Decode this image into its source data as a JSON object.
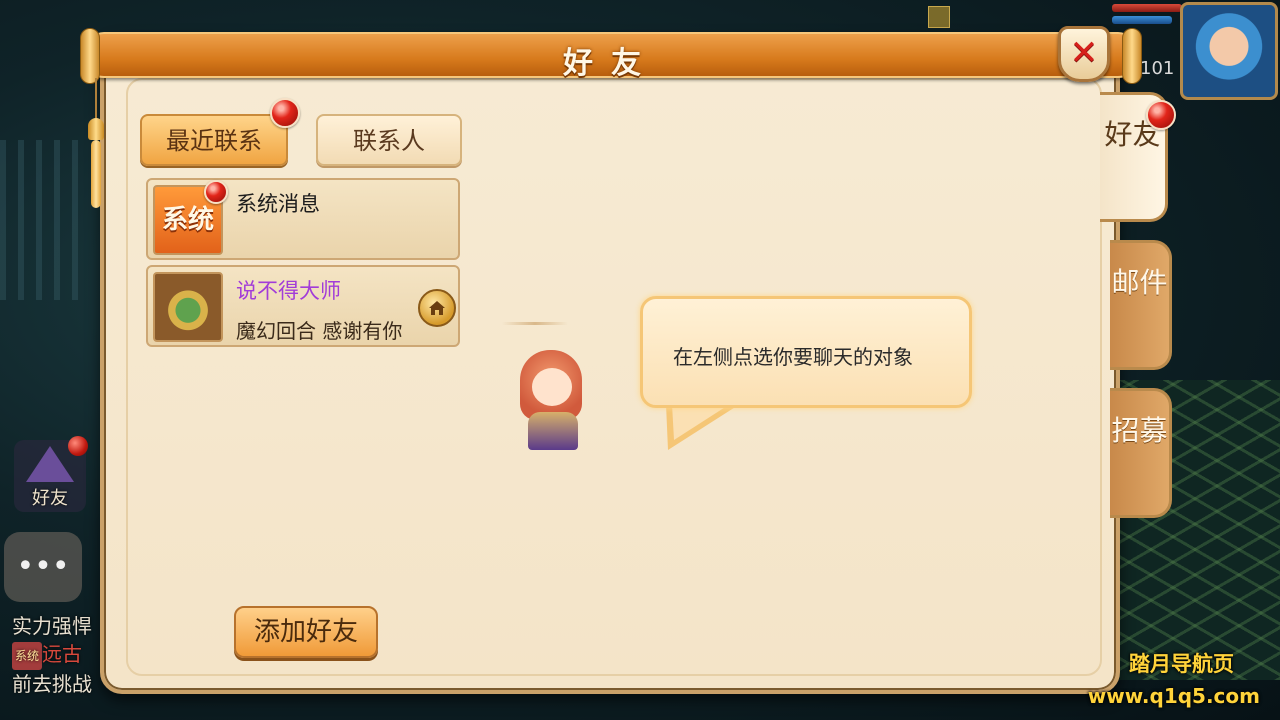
{
  "dialog": {
    "title": "好友",
    "close_label": "✕"
  },
  "tabs": {
    "recent_label": "最近联系",
    "contacts_label": "联系人"
  },
  "conversations": [
    {
      "name": "系统消息",
      "subtitle": "",
      "avatar_text": "系统",
      "has_badge": true
    },
    {
      "name": "说不得大师",
      "subtitle": "魔幻回合  感谢有你",
      "name_color": "#a23cd8",
      "has_home_icon": true
    }
  ],
  "empty_state": {
    "message": "在左侧点选你要聊天的对象"
  },
  "buttons": {
    "add_friend_label": "添加好友"
  },
  "side_tabs": [
    {
      "label": "好友",
      "active": true,
      "badge": true
    },
    {
      "label": "邮件",
      "active": false
    },
    {
      "label": "招募",
      "active": false
    }
  ],
  "hud": {
    "level": "101",
    "friend_shortcut_label": "好友",
    "chat_bubble_label": "•••",
    "chat_log": {
      "line1": "实力强悍",
      "tag": "系统",
      "line2_red": "远古",
      "line3": "前去挑战"
    }
  },
  "watermark": {
    "line1": "踏月导航页",
    "line2": "www.q1q5.com"
  },
  "colors": {
    "title_bar": "#d77a1c",
    "panel_bg": "#f7ebd4",
    "badge_red": "#e2251a",
    "friend_name_purple": "#a23cd8",
    "watermark_yellow": "#ffd33a"
  }
}
